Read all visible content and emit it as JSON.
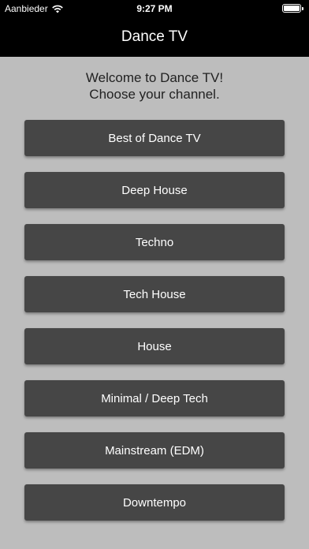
{
  "status_bar": {
    "carrier": "Aanbieder",
    "time": "9:27 PM",
    "battery_level": 1.0
  },
  "header": {
    "title": "Dance TV"
  },
  "welcome": {
    "line1": "Welcome to Dance TV!",
    "line2": "Choose your channel."
  },
  "channels": [
    {
      "label": "Best of Dance TV"
    },
    {
      "label": "Deep House"
    },
    {
      "label": "Techno"
    },
    {
      "label": "Tech House"
    },
    {
      "label": "House"
    },
    {
      "label": "Minimal / Deep Tech"
    },
    {
      "label": "Mainstream (EDM)"
    },
    {
      "label": "Downtempo"
    }
  ],
  "colors": {
    "background": "#bdbdbd",
    "header": "#000000",
    "button": "#464646",
    "button_text": "#ffffff"
  },
  "icons": {
    "wifi": "wifi-icon",
    "battery": "battery-icon"
  }
}
